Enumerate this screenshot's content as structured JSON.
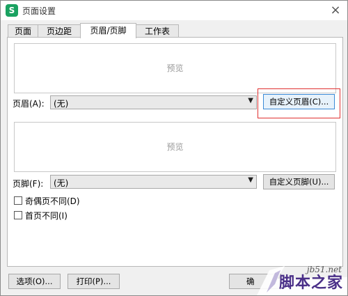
{
  "window": {
    "title": "页面设置",
    "app_icon": "S",
    "close_icon": "×"
  },
  "tabs": [
    {
      "label": "页面"
    },
    {
      "label": "页边距"
    },
    {
      "label": "页眉/页脚",
      "active": true
    },
    {
      "label": "工作表"
    }
  ],
  "header": {
    "preview_text": "预览",
    "label": "页眉(A):",
    "selected_value": "(无)",
    "custom_button": "自定义页眉(C)..."
  },
  "footer": {
    "preview_text": "预览",
    "label": "页脚(F):",
    "selected_value": "(无)",
    "custom_button": "自定义页脚(U)..."
  },
  "options": [
    {
      "label": "奇偶页不同(D)",
      "checked": false
    },
    {
      "label": "首页不同(I)",
      "checked": false
    }
  ],
  "bottom": {
    "options_button": "选项(O)...",
    "print_button": "打印(P)...",
    "ok_button": "确"
  },
  "watermark": {
    "site": "jb51.net",
    "name": "脚本之家"
  },
  "colors": {
    "highlight_border": "#e03030",
    "focus_button_border": "#3a8ad6",
    "app_icon_bg": "#1aa261",
    "watermark_text": "#4a2f88"
  }
}
